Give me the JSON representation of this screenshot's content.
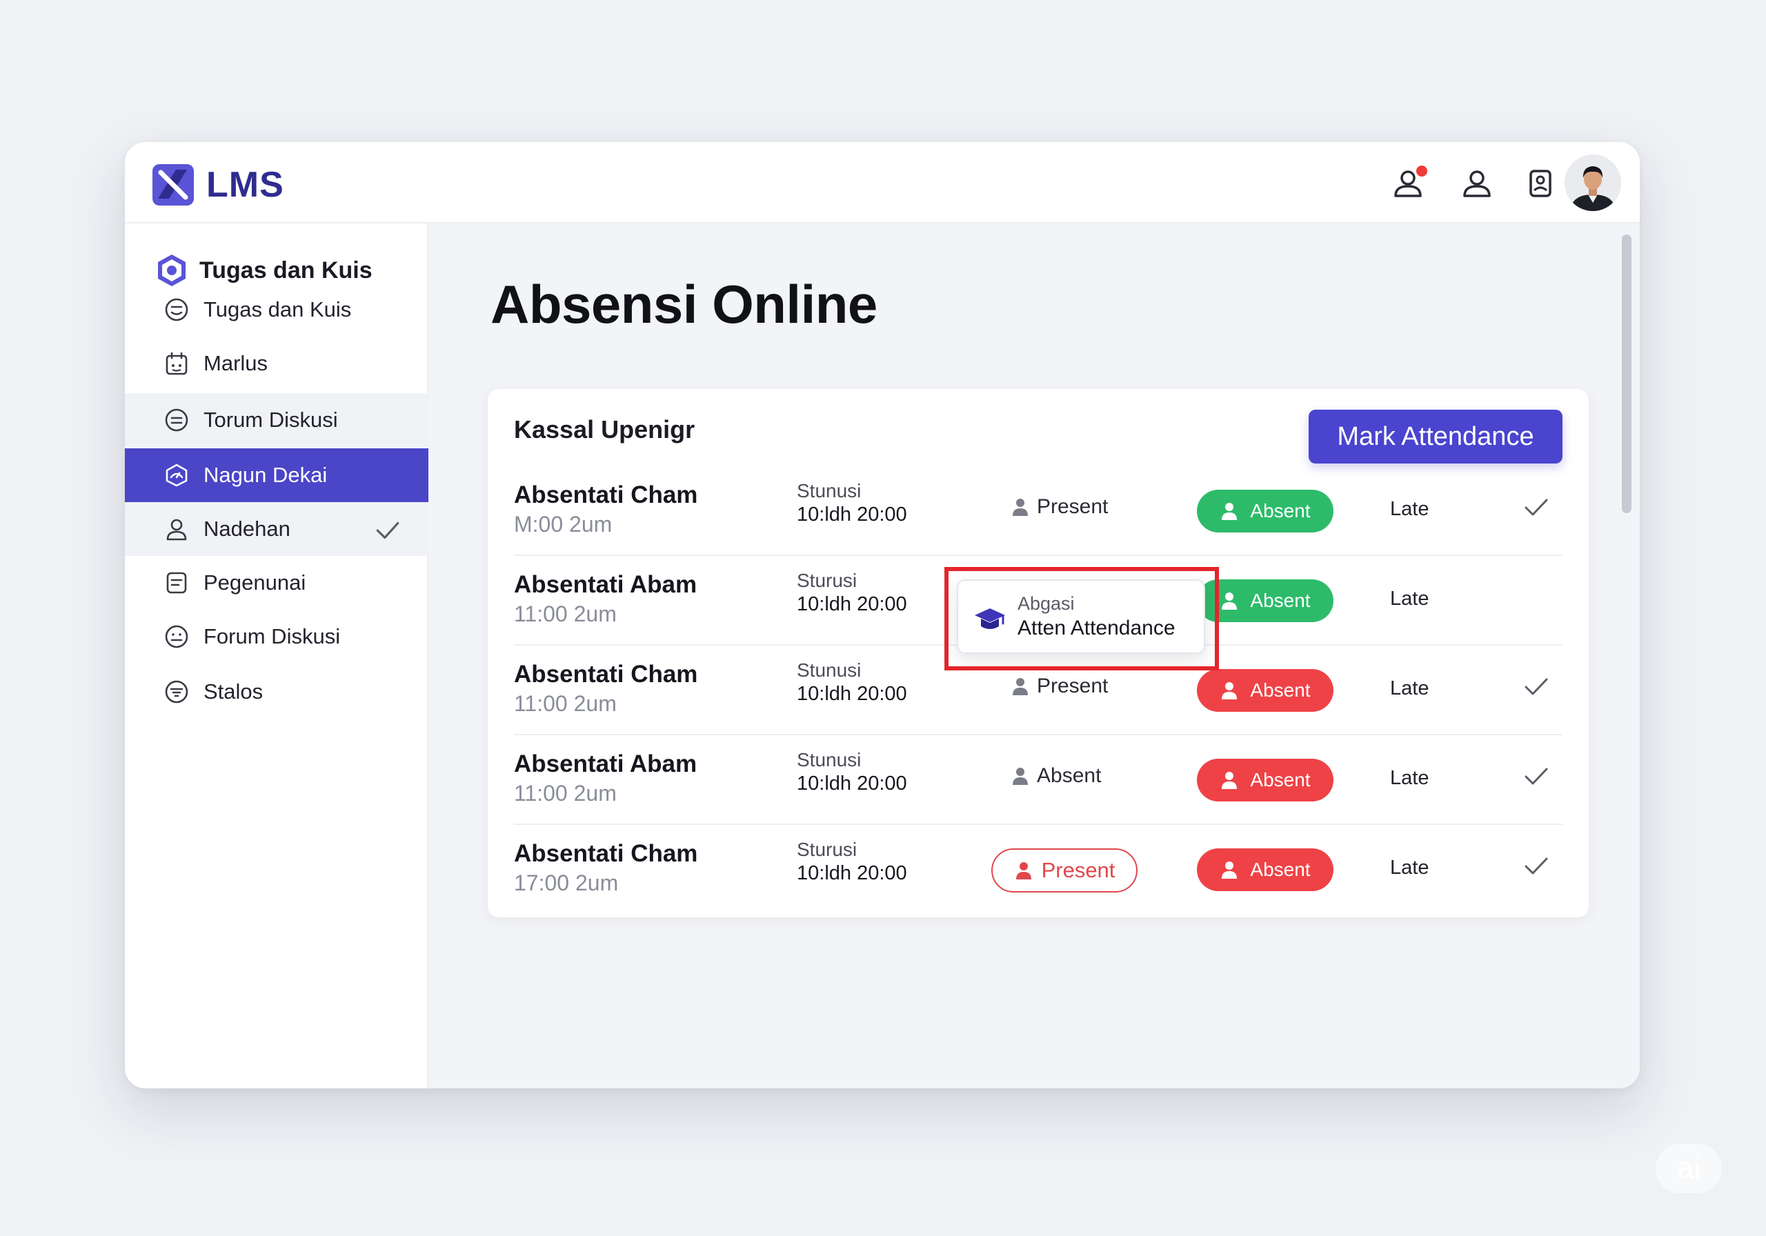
{
  "app": {
    "logo_text": "LMS",
    "brand_color": "#4b45c8"
  },
  "topbar": {
    "icons": [
      "user-notification-icon",
      "user-icon",
      "id-badge-icon",
      "avatar"
    ],
    "notification_dot_color": "#ef3b3b"
  },
  "sidebar": {
    "header": "Tugas dan Kuis",
    "items": [
      {
        "label": "Tugas dan Kuis",
        "icon": "smile-circle-icon",
        "state": "normal"
      },
      {
        "label": "Marlus",
        "icon": "calendar-icon",
        "state": "normal"
      },
      {
        "label": "Torum Diskusi",
        "icon": "list-circle-icon",
        "state": "hover"
      },
      {
        "label": "Nagun Dekai",
        "icon": "gauge-icon",
        "state": "active"
      },
      {
        "label": "Nadehan",
        "icon": "person-icon",
        "state": "hover",
        "checked": true
      },
      {
        "label": "Pegenunai",
        "icon": "document-icon",
        "state": "normal"
      },
      {
        "label": "Forum Diskusi",
        "icon": "smile-circle-icon",
        "state": "normal"
      },
      {
        "label": "Stalos",
        "icon": "filter-circle-icon",
        "state": "normal"
      }
    ]
  },
  "main": {
    "title": "Absensi Online",
    "card": {
      "title": "Kassal Upenigr",
      "mark_button": "Mark Attendance",
      "rows": [
        {
          "name": "Absentati Cham",
          "time": "M:00 2um",
          "label": "Stunusi",
          "date": "10:ldh 20:00",
          "status": "Present",
          "status_style": "plain",
          "pill": "Absent",
          "pill_color": "green",
          "late": "Late",
          "checked": true
        },
        {
          "name": "Absentati Abam",
          "time": "11:00 2um",
          "label": "Sturusi",
          "date": "10:ldh 20:00",
          "status": "",
          "status_style": "hidden",
          "pill": "Absent",
          "pill_color": "green",
          "late": "Late",
          "checked": false
        },
        {
          "name": "Absentati Cham",
          "time": "11:00 2um",
          "label": "Stunusi",
          "date": "10:ldh 20:00",
          "status": "Present",
          "status_style": "plain",
          "pill": "Absent",
          "pill_color": "red",
          "late": "Late",
          "checked": true
        },
        {
          "name": "Absentati Abam",
          "time": "11:00 2um",
          "label": "Stunusi",
          "date": "10:ldh 20:00",
          "status": "Absent",
          "status_style": "plain",
          "pill": "Absent",
          "pill_color": "red",
          "late": "Late",
          "checked": true
        },
        {
          "name": "Absentati Cham",
          "time": "17:00 2um",
          "label": "Sturusi",
          "date": "10:ldh 20:00",
          "status": "Present",
          "status_style": "outline",
          "pill": "Absent",
          "pill_color": "red",
          "late": "Late",
          "checked": true
        }
      ]
    },
    "popup": {
      "subtitle": "Abgasi",
      "title": "Atten Attendance",
      "icon": "graduation-cap-icon"
    }
  },
  "watermark": {
    "text": "ai"
  }
}
